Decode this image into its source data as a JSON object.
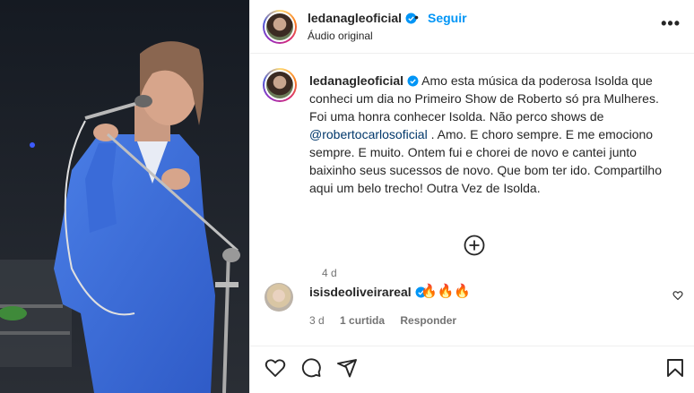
{
  "post": {
    "author": "ledanagleoficial",
    "follow_label": "Seguir",
    "separator": "•",
    "audio": "Áudio original",
    "more_label": "•••"
  },
  "caption": {
    "author": "ledanagleoficial",
    "text_part1": "Amo esta música da poderosa Isolda que conheci um dia no Primeiro Show de Roberto só pra Mulheres. Foi uma honra conhecer Isolda. Não perco shows de",
    "mention": "@robertocarlosoficial",
    "text_part2": ". Amo. E choro sempre. E me emociono sempre. E muito. Ontem fui e chorei de novo e cantei junto baixinho seus sucessos de novo. Que bom ter ido. Compartilho aqui um belo trecho! Outra Vez de Isolda.",
    "age": "4 d"
  },
  "comment": {
    "user": "isisdeoliveirareal",
    "text": "🔥🔥🔥",
    "age": "3 d",
    "likes": "1 curtida",
    "reply_label": "Responder"
  },
  "colors": {
    "accent": "#0095f6",
    "verified": "#0095f6",
    "suit": "#3f6fd6"
  }
}
